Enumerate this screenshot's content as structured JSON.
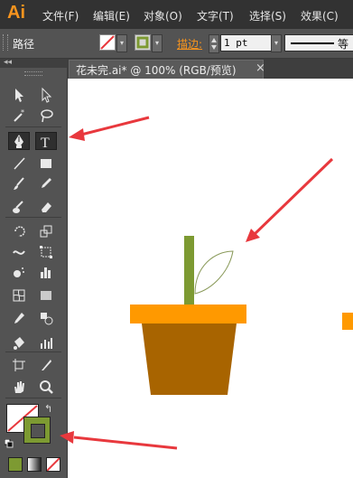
{
  "app": {
    "logo": "Ai",
    "accent": "#f7941e"
  },
  "menu": [
    "文件(F)",
    "编辑(E)",
    "对象(O)",
    "文字(T)",
    "选择(S)",
    "效果(C)"
  ],
  "control_bar": {
    "object_type": "路径",
    "fill_icon": "none-swatch-icon",
    "stroke_icon": "stroke-swatch-icon",
    "stroke_label": "描边:",
    "stroke_weight": "1 pt",
    "profile_label": "等"
  },
  "document": {
    "tab_title": "花未完.ai* @ 100% (RGB/预览)",
    "close": "×"
  },
  "tools": [
    "selection-tool",
    "direct-selection-tool",
    "magic-wand-tool",
    "lasso-tool",
    "pen-tool",
    "type-tool",
    "line-segment-tool",
    "rectangle-tool",
    "paintbrush-tool",
    "pencil-tool",
    "blob-brush-tool",
    "eraser-tool",
    "rotate-tool",
    "scale-tool",
    "warp-tool",
    "free-transform-tool",
    "symbol-sprayer-tool",
    "column-graph-tool",
    "mesh-tool",
    "gradient-tool",
    "eyedropper-tool",
    "blend-tool",
    "live-paint-bucket-tool",
    "chart-tool",
    "artboard-tool",
    "slice-tool",
    "hand-tool",
    "zoom-tool"
  ],
  "colors": {
    "stem": "#7d9a32",
    "pot_rim": "#ff9900",
    "pot_body": "#a86400",
    "leaf_stroke": "#8a9a5a",
    "stroke_swatch": "#7d9a32",
    "arrow": "#e8383d"
  },
  "swatches": {
    "fill": "none",
    "stroke": "#7d9a32",
    "mode_buttons": [
      "color-mode",
      "gradient-mode",
      "none-mode"
    ]
  }
}
